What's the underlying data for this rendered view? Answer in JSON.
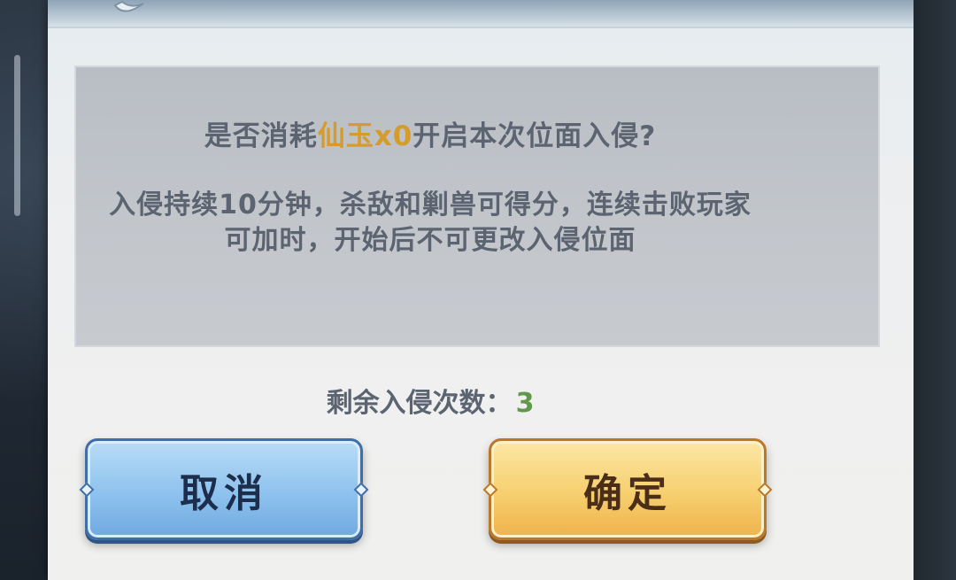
{
  "dialog": {
    "prompt_prefix": "是否消耗",
    "prompt_cost": "仙玉x0",
    "prompt_suffix": "开启本次位面入侵?",
    "info_line1": "入侵持续10分钟，杀敌和剿兽可得分，连续击败玩家",
    "info_line2": "可加时，开始后不可更改入侵位面",
    "remaining_label": "剩余入侵次数：",
    "remaining_count": "3"
  },
  "buttons": {
    "cancel_label": "取消",
    "confirm_label": "确定"
  },
  "colors": {
    "cost_highlight": "#d59b2b",
    "count_highlight": "#5f9a4a",
    "cancel_button": "#8ec2ee",
    "confirm_button": "#f7cf6e",
    "body_text": "#5b6470"
  },
  "icons": {
    "header_emblem": "leaf-emblem-icon",
    "button_notches": "diamond-notch-icon"
  }
}
